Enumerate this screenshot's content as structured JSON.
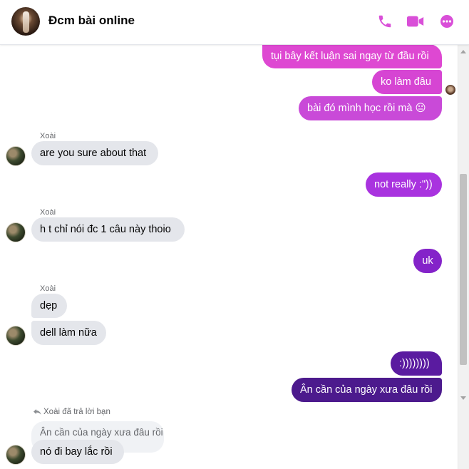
{
  "header": {
    "title": "Đcm bài online",
    "icons": [
      "phone-icon",
      "video-icon",
      "more-icon"
    ]
  },
  "colors": {
    "accent": "#d94fd8",
    "outgoing_gradient": [
      "#de48d2",
      "#c23be0",
      "#a52fdc",
      "#7b1fc4",
      "#57199d",
      "#4d1a8f"
    ],
    "incoming": "#e4e6eb"
  },
  "messages": [
    {
      "from": "me",
      "text": "tụi bây kết luận sai ngay từ đầu rồi"
    },
    {
      "from": "me",
      "text": "ko làm đâu"
    },
    {
      "from": "me",
      "text": "bài đó mình học rồi mà 😐"
    },
    {
      "sender": "Xoài",
      "text": "are you sure about that"
    },
    {
      "from": "me",
      "text": "not really :\"))"
    },
    {
      "sender": "Xoài",
      "text": "h t chỉ nói đc 1 câu này thoio"
    },
    {
      "from": "me",
      "text": "uk"
    },
    {
      "sender": "Xoài",
      "text": "dẹp"
    },
    {
      "sender": "Xoài",
      "text": "dell làm nữa"
    },
    {
      "from": "me",
      "text": ":))))))))"
    },
    {
      "from": "me",
      "text": "Ân cần của ngày xưa đâu rồi"
    }
  ],
  "reply": {
    "note": "Xoài đã trả lời bạn",
    "quoted": "Ân cần của ngày xưa đâu rồi",
    "text": "nó đi bay lắc rồi"
  }
}
